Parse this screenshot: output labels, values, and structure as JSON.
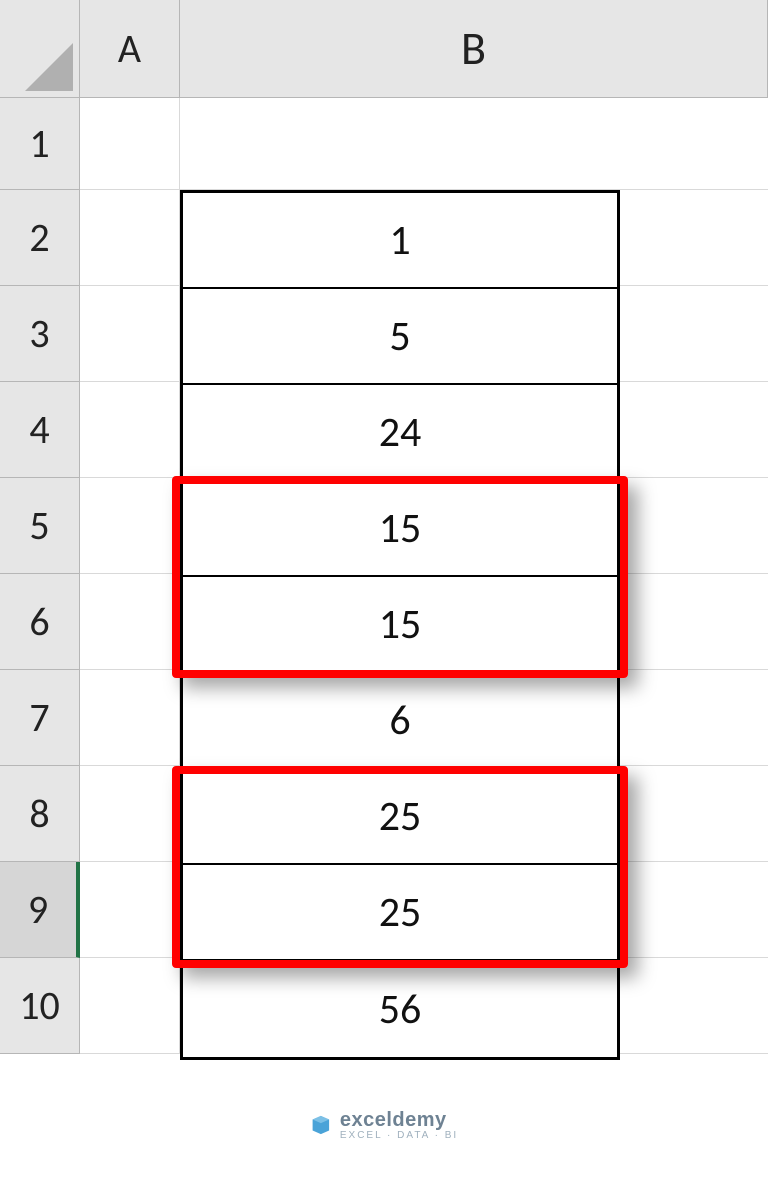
{
  "headers": {
    "col_A": "A",
    "col_B": "B",
    "rows": [
      "1",
      "2",
      "3",
      "4",
      "5",
      "6",
      "7",
      "8",
      "9",
      "10"
    ]
  },
  "active_row": "9",
  "data_cells": {
    "B2": "1",
    "B3": "5",
    "B4": "24",
    "B5": "15",
    "B6": "15",
    "B7": "6",
    "B8": "25",
    "B9": "25",
    "B10": "56"
  },
  "highlights": [
    {
      "range": "B5:B6"
    },
    {
      "range": "B8:B9"
    }
  ],
  "watermark": {
    "brand": "exceldemy",
    "tagline": "EXCEL · DATA · BI"
  }
}
